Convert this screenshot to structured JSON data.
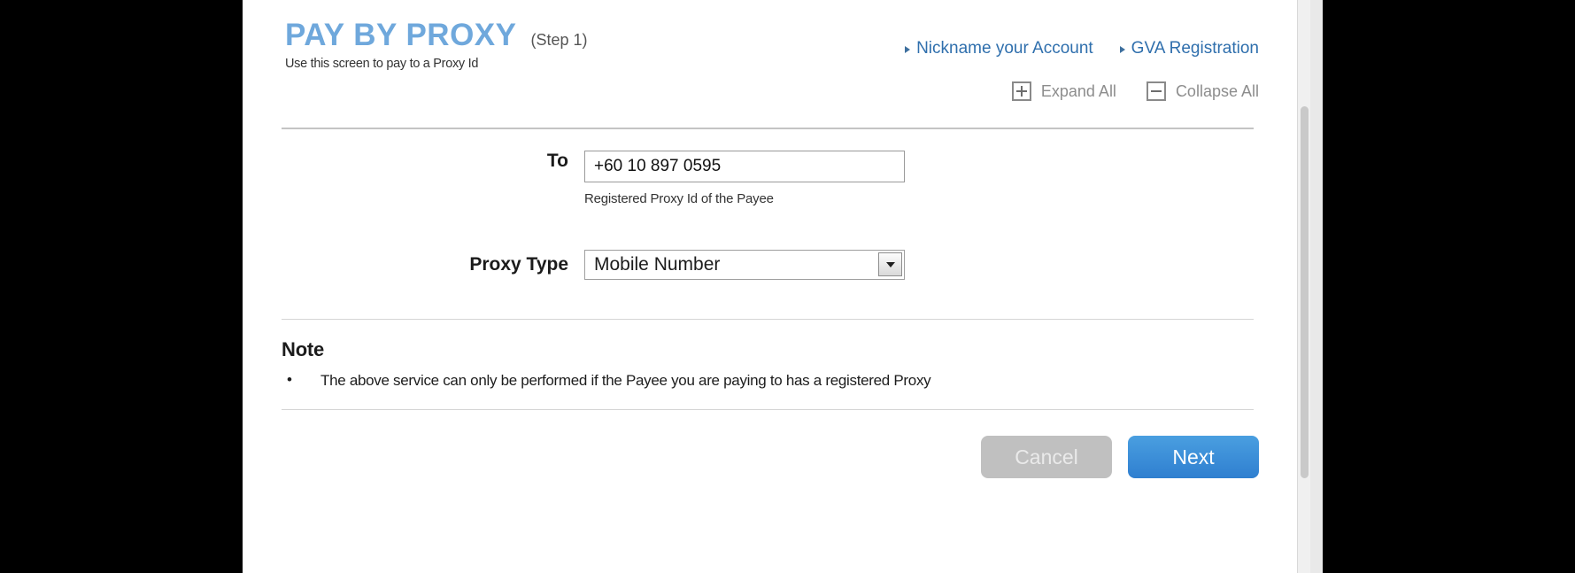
{
  "header": {
    "app_title": "PAY BY PROXY",
    "step": "(Step 1)",
    "subtitle": "Use this screen to pay to a Proxy Id"
  },
  "top_links": [
    {
      "label": "Nickname your Account"
    },
    {
      "label": "GVA Registration"
    }
  ],
  "toggles": {
    "expand_label": "Expand All",
    "collapse_label": "Collapse All"
  },
  "form": {
    "to": {
      "label": "To",
      "value": "+60 10 897 0595",
      "placeholder": "",
      "helper": "Registered Proxy Id of the Payee"
    },
    "proxy_type": {
      "label": "Proxy Type",
      "value": "Mobile Number"
    }
  },
  "note": {
    "heading": "Note",
    "bullet": "•",
    "items": [
      "The above service can only be performed if the Payee you are paying to has a registered Proxy"
    ]
  },
  "buttons": {
    "cancel": "Cancel",
    "next": "Next"
  },
  "colors": {
    "brand_blue": "#6fa8dc",
    "link_blue": "#2f6fad",
    "next_button": "#3f8fd8",
    "cancel_button": "#c0c0c0",
    "muted_gray": "#8d8d8d"
  }
}
